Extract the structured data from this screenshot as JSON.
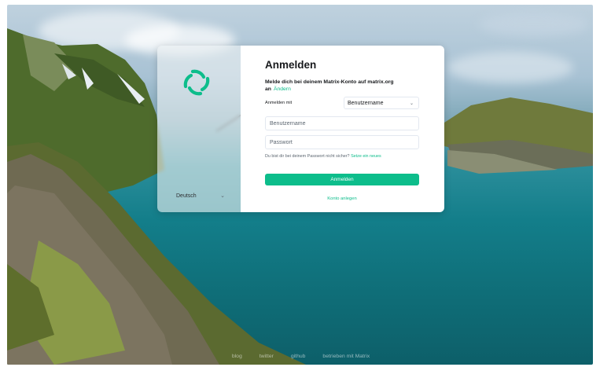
{
  "brand": {
    "accent": "#0dbd8b",
    "logo": "element-logo-icon"
  },
  "language": {
    "selected": "Deutsch"
  },
  "login": {
    "title": "Anmelden",
    "subtitle_prefix": "Melde dich bei deinem Matrix-Konto auf ",
    "server": "matrix.org",
    "subtitle_suffix": "an",
    "change_link": "Ändern",
    "login_with_label": "Anmelden mit",
    "login_type": "Benutzername",
    "username_placeholder": "Benutzername",
    "password_placeholder": "Passwort",
    "forgot_text": "Du bist dir bei deinem Passwort nicht sicher?",
    "forgot_link": "Setze ein neues",
    "submit_label": "Anmelden",
    "create_account": "Konto anlegen"
  },
  "footer": {
    "links": [
      "blog",
      "twitter",
      "github",
      "betrieben mit Matrix"
    ]
  }
}
